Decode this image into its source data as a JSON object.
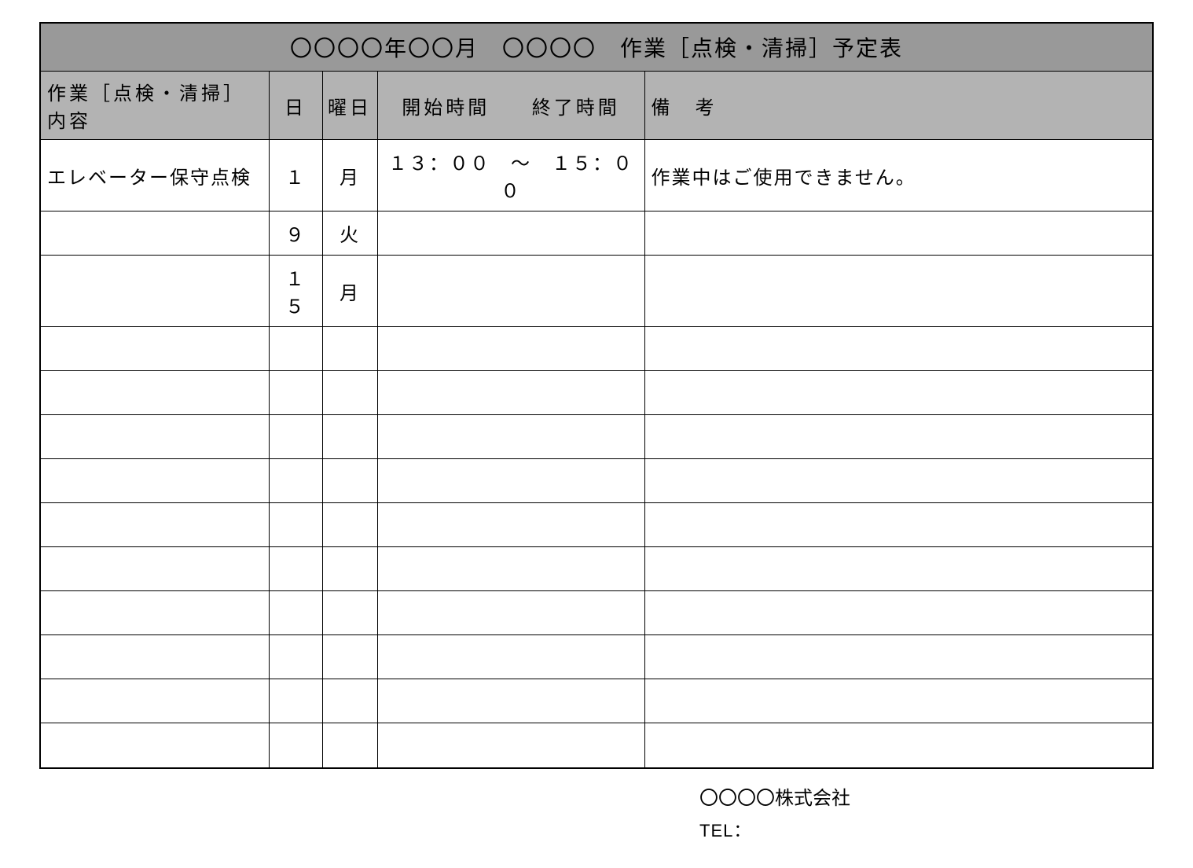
{
  "title": "〇〇〇〇年〇〇月　〇〇〇〇　作業［点検・清掃］予定表",
  "headers": {
    "content": "作業［点検・清掃］内容",
    "day": "日",
    "weekday": "曜日",
    "start_time": "開始時間",
    "end_time": "終了時間",
    "remarks": "備　考"
  },
  "rows": [
    {
      "content": "エレベーター保守点検",
      "day": "１",
      "weekday": "月",
      "start_time": "１３：００",
      "tilde": "～",
      "end_time": "１５：００",
      "remarks": "作業中はご使用できません。"
    },
    {
      "content": "",
      "day": "９",
      "weekday": "火",
      "start_time": "",
      "tilde": "",
      "end_time": "",
      "remarks": ""
    },
    {
      "content": "",
      "day": "１５",
      "weekday": "月",
      "start_time": "",
      "tilde": "",
      "end_time": "",
      "remarks": ""
    },
    {
      "content": "",
      "day": "",
      "weekday": "",
      "start_time": "",
      "tilde": "",
      "end_time": "",
      "remarks": ""
    },
    {
      "content": "",
      "day": "",
      "weekday": "",
      "start_time": "",
      "tilde": "",
      "end_time": "",
      "remarks": ""
    },
    {
      "content": "",
      "day": "",
      "weekday": "",
      "start_time": "",
      "tilde": "",
      "end_time": "",
      "remarks": ""
    },
    {
      "content": "",
      "day": "",
      "weekday": "",
      "start_time": "",
      "tilde": "",
      "end_time": "",
      "remarks": ""
    },
    {
      "content": "",
      "day": "",
      "weekday": "",
      "start_time": "",
      "tilde": "",
      "end_time": "",
      "remarks": ""
    },
    {
      "content": "",
      "day": "",
      "weekday": "",
      "start_time": "",
      "tilde": "",
      "end_time": "",
      "remarks": ""
    },
    {
      "content": "",
      "day": "",
      "weekday": "",
      "start_time": "",
      "tilde": "",
      "end_time": "",
      "remarks": ""
    },
    {
      "content": "",
      "day": "",
      "weekday": "",
      "start_time": "",
      "tilde": "",
      "end_time": "",
      "remarks": ""
    },
    {
      "content": "",
      "day": "",
      "weekday": "",
      "start_time": "",
      "tilde": "",
      "end_time": "",
      "remarks": ""
    },
    {
      "content": "",
      "day": "",
      "weekday": "",
      "start_time": "",
      "tilde": "",
      "end_time": "",
      "remarks": ""
    }
  ],
  "footer": {
    "company": "〇〇〇〇株式会社",
    "tel_label": "TEL："
  }
}
